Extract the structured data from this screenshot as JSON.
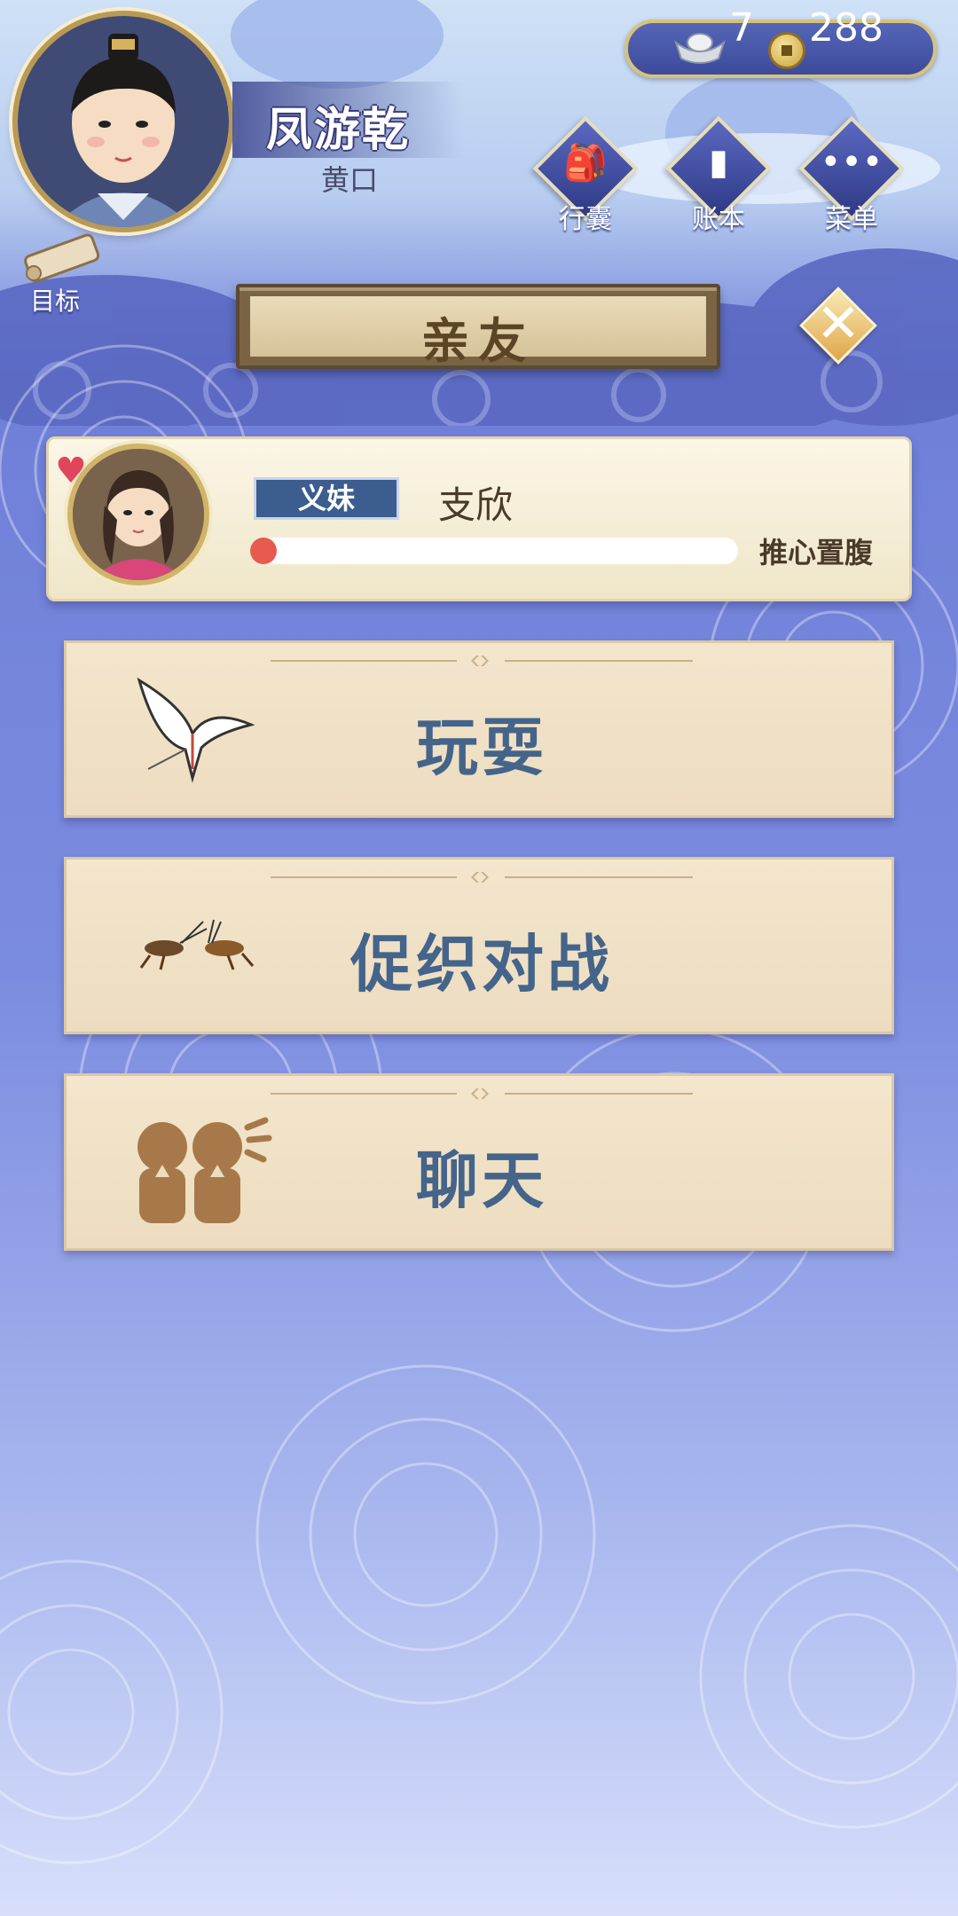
{
  "player": {
    "name": "凤游乾",
    "title": "黄口"
  },
  "currency": {
    "silver": "7",
    "coins": "288"
  },
  "menu": [
    {
      "label": "行囊",
      "icon": "bag-icon"
    },
    {
      "label": "账本",
      "icon": "ledger-icon"
    },
    {
      "label": "菜单",
      "icon": "more-icon"
    }
  ],
  "goal": {
    "label": "目标"
  },
  "page": {
    "title": "亲友"
  },
  "friend": {
    "relation": "义妹",
    "name": "支欣",
    "bond_label": "推心置腹",
    "bond_progress": 0.05
  },
  "actions": [
    {
      "label": "玩耍",
      "icon": "kite-icon"
    },
    {
      "label": "促织对战",
      "icon": "cricket-icon"
    },
    {
      "label": "聊天",
      "icon": "chat-icon"
    }
  ],
  "colors": {
    "accent": "#44648a",
    "bond_fill": "#e65a4f",
    "banner_text": "#5b4526"
  }
}
